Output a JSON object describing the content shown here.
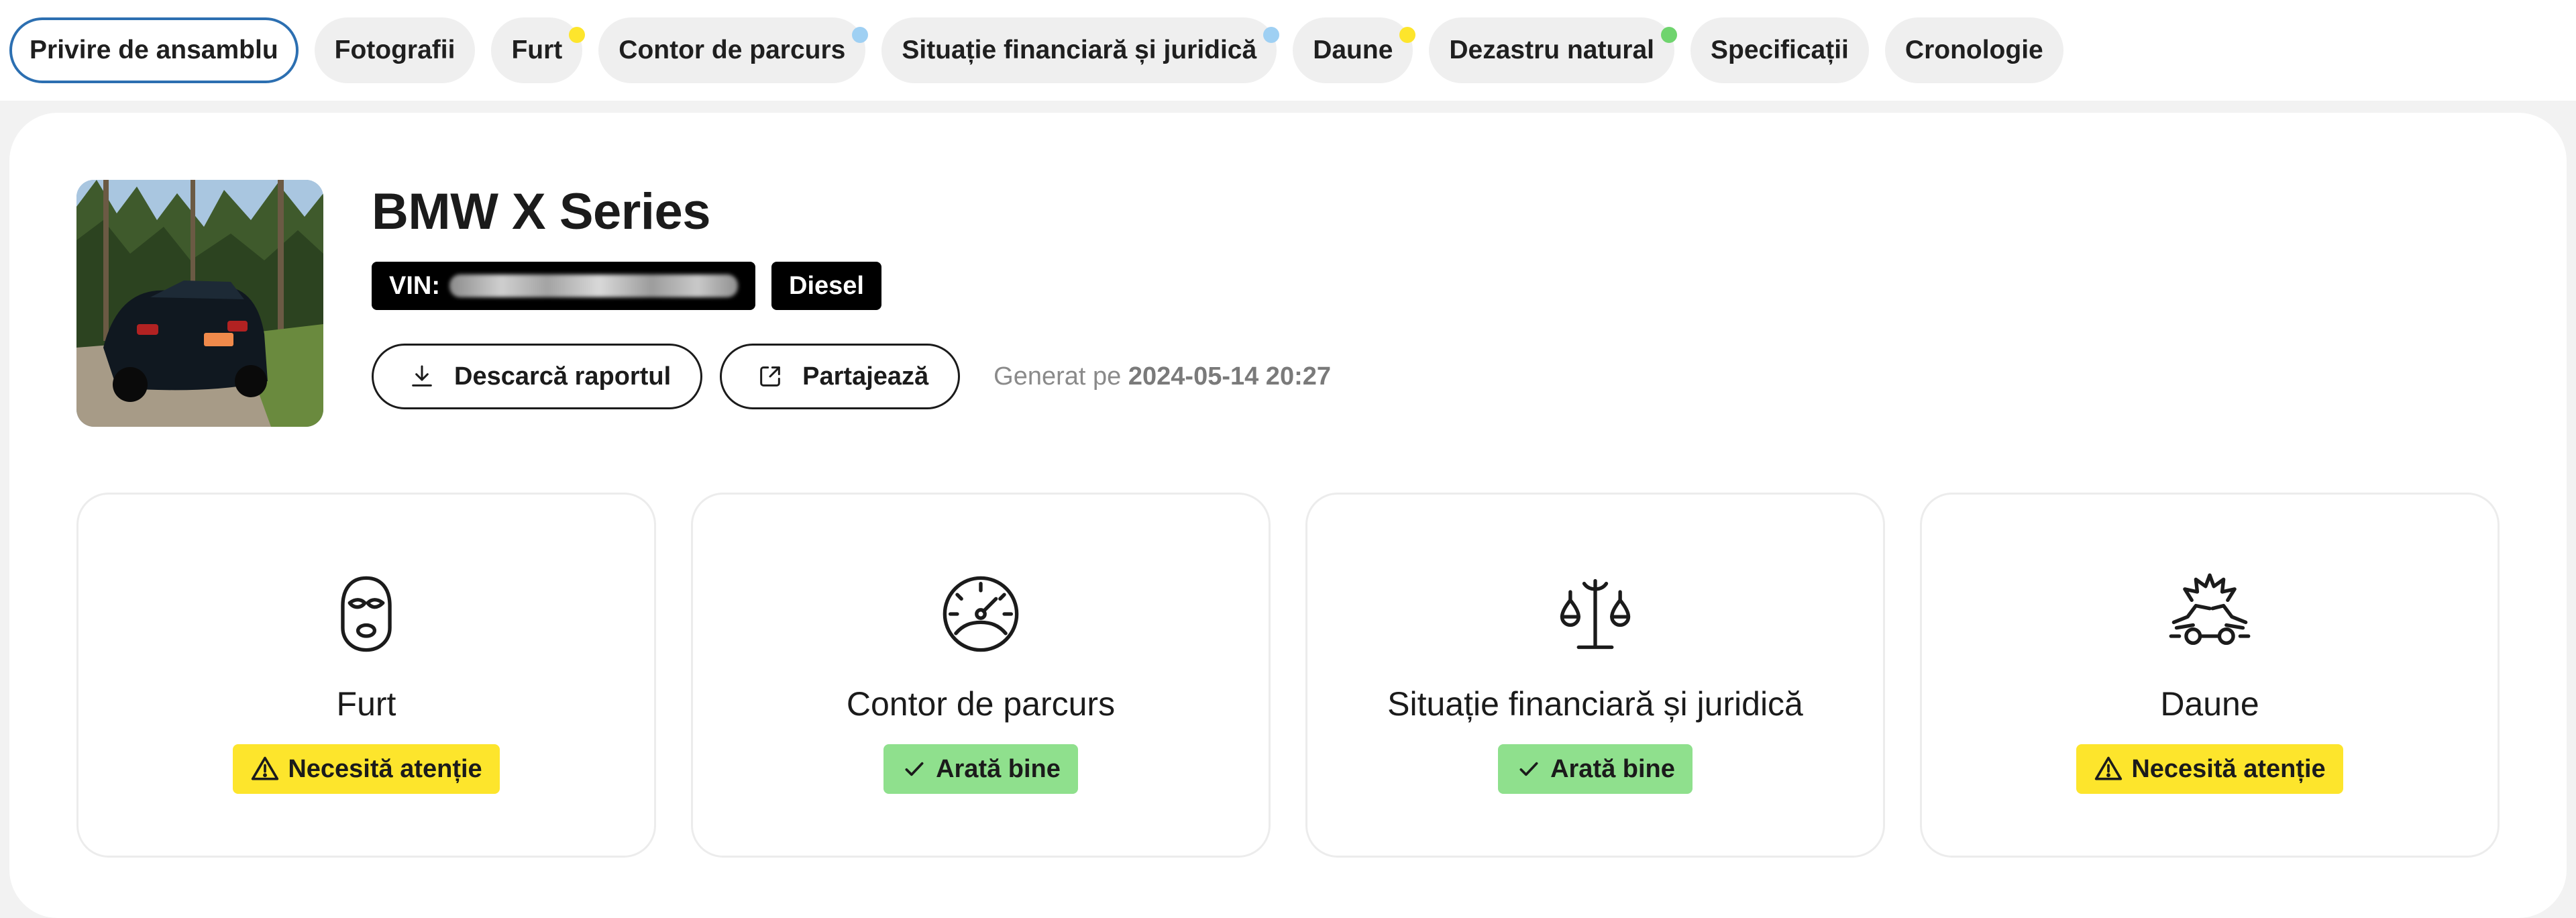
{
  "tabs": [
    {
      "label": "Privire de ansamblu",
      "active": true,
      "dot": null
    },
    {
      "label": "Fotografii",
      "active": false,
      "dot": null
    },
    {
      "label": "Furt",
      "active": false,
      "dot": "#fde52c"
    },
    {
      "label": "Contor de parcurs",
      "active": false,
      "dot": "#9fd0f3"
    },
    {
      "label": "Situație financiară și juridică",
      "active": false,
      "dot": "#9fd0f3"
    },
    {
      "label": "Daune",
      "active": false,
      "dot": "#fde52c"
    },
    {
      "label": "Dezastru natural",
      "active": false,
      "dot": "#6fd46e"
    },
    {
      "label": "Specificații",
      "active": false,
      "dot": null
    },
    {
      "label": "Cronologie",
      "active": false,
      "dot": null
    }
  ],
  "vehicle": {
    "title": "BMW X Series",
    "vin_label": "VIN:",
    "fuel": "Diesel"
  },
  "actions": {
    "download_label": "Descarcă raportul",
    "share_label": "Partajează",
    "generated_prefix": "Generat pe",
    "generated_date": "2024-05-14 20:27"
  },
  "summary": [
    {
      "label": "Furt",
      "icon": "balaclava-icon",
      "status": "Necesită atenție",
      "status_type": "warn"
    },
    {
      "label": "Contor de parcurs",
      "icon": "speedometer-icon",
      "status": "Arată bine",
      "status_type": "ok"
    },
    {
      "label": "Situație financiară și juridică",
      "icon": "scales-icon",
      "status": "Arată bine",
      "status_type": "ok"
    },
    {
      "label": "Daune",
      "icon": "car-crash-icon",
      "status": "Necesită atenție",
      "status_type": "warn"
    }
  ],
  "colors": {
    "active_tab_border": "#2c6fb1",
    "warn": "#fde52c",
    "ok": "#8fe08d"
  }
}
